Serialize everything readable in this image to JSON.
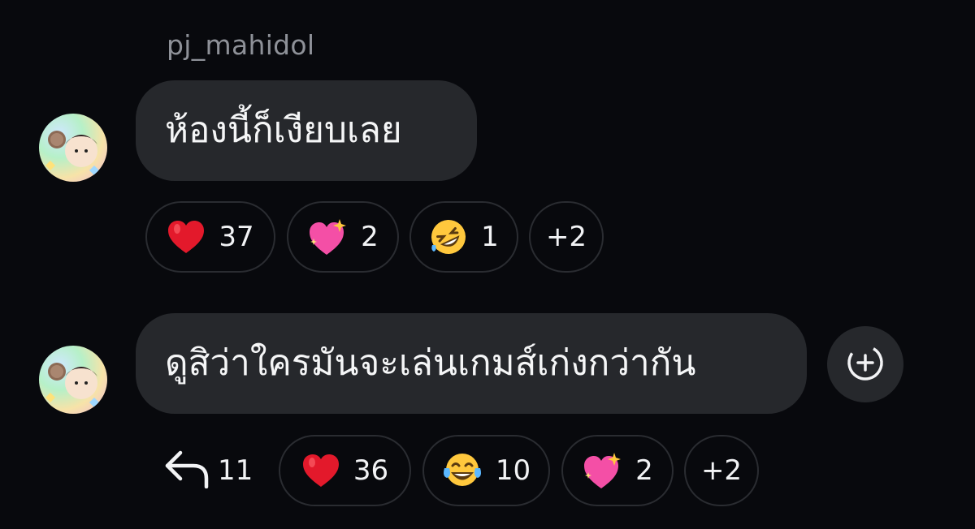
{
  "message1": {
    "sender": "pj_mahidol",
    "text": "ห้องนี้ก็เงียบเลย",
    "avatar_icon": "user-avatar",
    "reactions": [
      {
        "emoji": "heart-emoji",
        "count": "37"
      },
      {
        "emoji": "sparkling-heart-emoji",
        "count": "2"
      },
      {
        "emoji": "rolling-on-floor-laughing-emoji",
        "count": "1"
      }
    ],
    "more_reactions": "+2"
  },
  "message2": {
    "text": "ดูสิว่าใครมันจะเล่นเกมส์เก่งกว่ากัน",
    "avatar_icon": "user-avatar",
    "reply_icon": "reply-arrow-icon",
    "reply_count": "11",
    "add_reaction_icon": "add-reaction-icon",
    "reactions": [
      {
        "emoji": "heart-emoji",
        "count": "36"
      },
      {
        "emoji": "face-with-tears-of-joy-emoji",
        "count": "10"
      },
      {
        "emoji": "sparkling-heart-emoji",
        "count": "2"
      }
    ],
    "more_reactions": "+2"
  },
  "colors": {
    "background": "#08090d",
    "bubble": "#26282c",
    "chip_border": "#2a2c31",
    "sender_name": "#8e9198",
    "heart": "#e3192b",
    "pink_heart": "#f44fa6",
    "emoji_yellow": "#ffc83d"
  }
}
